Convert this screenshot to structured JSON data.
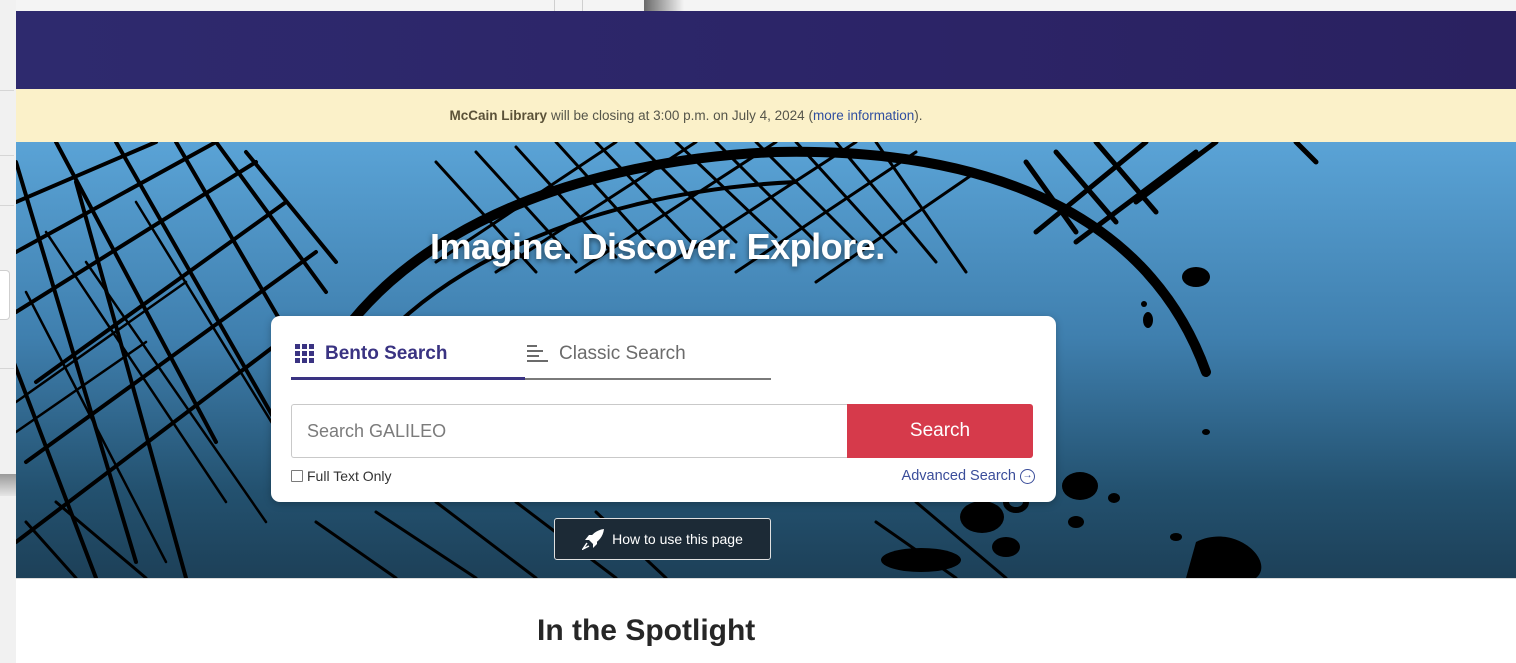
{
  "alert": {
    "library": "McCain Library",
    "message": "will be closing at 3:00 p.m. on July 4, 2024",
    "link_open": "(",
    "link_text": "more information",
    "link_close": ")."
  },
  "hero": {
    "title": "Imagine. Discover. Explore."
  },
  "search": {
    "tabs": [
      {
        "label": "Bento Search",
        "icon": "grid-icon",
        "active": true
      },
      {
        "label": "Classic Search",
        "icon": "list-lines-icon",
        "active": false
      }
    ],
    "placeholder": "Search GALILEO",
    "button_label": "Search",
    "fulltext_label": "Full Text Only",
    "advanced_label": "Advanced Search"
  },
  "howto": {
    "label": "How to use this page",
    "icon": "rocket-icon"
  },
  "spotlight": {
    "heading": "In the Spotlight"
  },
  "colors": {
    "header": "#2c2467",
    "banner": "#fbf1c9",
    "accent": "#3a3382",
    "search_button": "#d63a4b"
  }
}
